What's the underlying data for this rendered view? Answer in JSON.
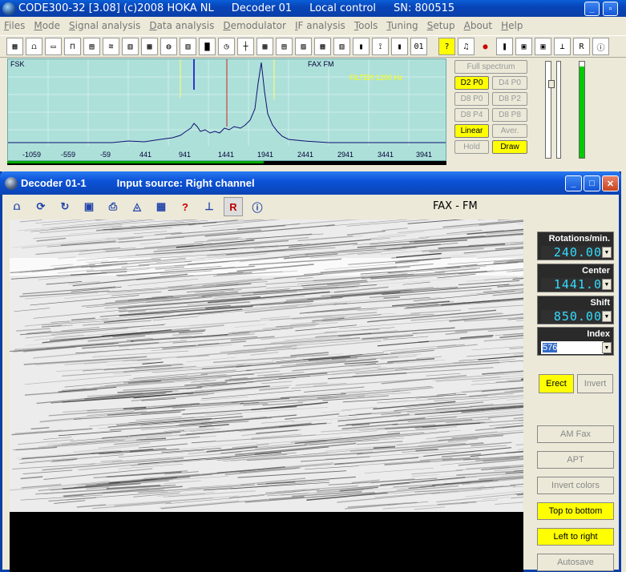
{
  "app": {
    "title_segments": [
      "CODE300-32 [3.08] (c)2008 HOKA NL",
      "Decoder 01",
      "Local control",
      "SN: 800515"
    ]
  },
  "menu": [
    "Files",
    "Mode",
    "Signal analysis",
    "Data analysis",
    "Demodulator",
    "IF analysis",
    "Tools",
    "Tuning",
    "Setup",
    "About",
    "Help"
  ],
  "spectrum": {
    "left_label": "FSK",
    "mode_label": "FAX FM",
    "filter_label": "FILTER 1200 Hz",
    "ticks": [
      "-1059",
      "-559",
      "-59",
      "441",
      "941",
      "1441",
      "1941",
      "2441",
      "2941",
      "3441",
      "3941"
    ]
  },
  "spectrum_buttons": {
    "full": "Full spectrum",
    "d2p0": "D2 P0",
    "d4p0": "D4 P0",
    "d8p0": "D8 P0",
    "d8p2": "D8 P2",
    "d8p4": "D8 P4",
    "d8p8": "D8 P8",
    "linear": "Linear",
    "aver": "Aver.",
    "hold": "Hold",
    "draw": "Draw"
  },
  "decoder": {
    "window_title": "Decoder 01-1",
    "input_source": "Input source: Right channel",
    "mode": "FAX - FM",
    "rotations_label": "Rotations/min.",
    "rotations_value": "240.00",
    "center_label": "Center",
    "center_value": "1441.0",
    "shift_label": "Shift",
    "shift_value": "850.00",
    "index_label": "Index",
    "index_value": "576",
    "erect": "Erect",
    "invert": "Invert",
    "am_fax": "AM Fax",
    "apt": "APT",
    "invert_colors": "Invert colors",
    "top_to_bottom": "Top to bottom",
    "left_to_right": "Left to right",
    "autosave": "Autosave"
  },
  "colors": {
    "active": "#ffff00",
    "titlebar": "#0a44b4",
    "spectrum_bg": "#aee0da"
  }
}
